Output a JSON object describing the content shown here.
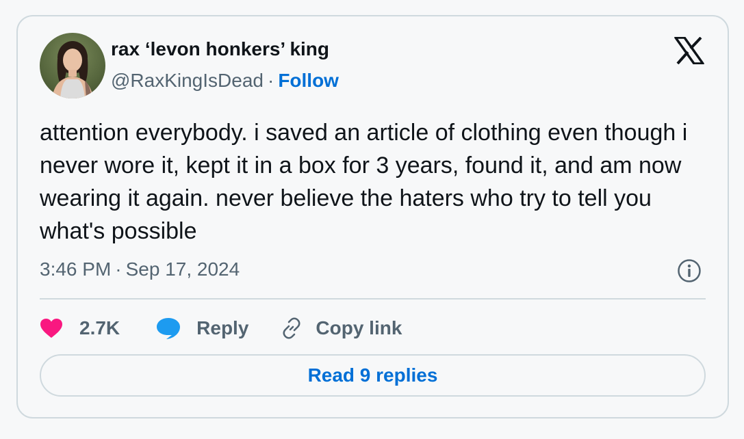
{
  "author": {
    "display_name": "rax ‘levon honkers’ king",
    "handle": "@RaxKingIsDead",
    "separator": "·",
    "follow_label": "Follow"
  },
  "tweet": {
    "text": "attention everybody. i saved an article of clothing even though i never wore it, kept it in a box for 3 years, found it, and am now wearing it again. never believe the haters who try to tell you what's possible",
    "time": "3:46 PM",
    "separator": "·",
    "date": "Sep 17, 2024"
  },
  "actions": {
    "like_count": "2.7K",
    "reply_label": "Reply",
    "copy_label": "Copy link"
  },
  "read_replies_label": "Read 9 replies",
  "icons": {
    "logo": "x-logo-icon",
    "info": "info-icon",
    "like": "heart-icon",
    "reply": "speech-bubble-icon",
    "copy": "link-icon"
  },
  "colors": {
    "follow_link": "#006fd6",
    "heart": "#f91880",
    "reply_bubble": "#1d9bf0",
    "secondary_text": "#536471",
    "border": "#cfd9de"
  }
}
